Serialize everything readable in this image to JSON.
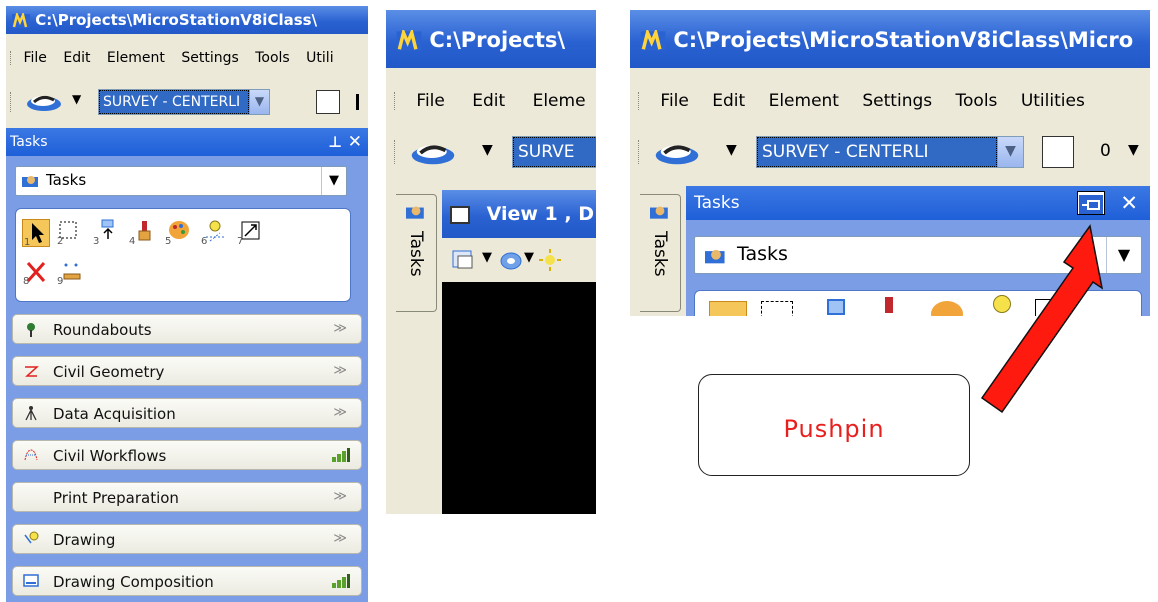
{
  "panel1": {
    "window_title": "C:\\Projects\\MicroStationV8iClass\\",
    "menu": [
      "File",
      "Edit",
      "Element",
      "Settings",
      "Tools",
      "Utili"
    ],
    "level_value": "SURVEY - CENTERLI",
    "tasks_header": "Tasks",
    "tasks_combo": "Tasks",
    "tool_numbers": [
      "1",
      "2",
      "3",
      "4",
      "5",
      "6",
      "7",
      "8",
      "9"
    ],
    "sections": [
      {
        "label": "Roundabouts",
        "icon": "roundabout-icon",
        "indicator": "chevron"
      },
      {
        "label": "Civil Geometry",
        "icon": "civil-geometry-icon",
        "indicator": "chevron"
      },
      {
        "label": "Data Acquisition",
        "icon": "survey-tripod-icon",
        "indicator": "chevron"
      },
      {
        "label": "Civil Workflows",
        "icon": "civil-workflows-icon",
        "indicator": "bars"
      },
      {
        "label": "Print Preparation",
        "icon": "",
        "indicator": "chevron"
      },
      {
        "label": "Drawing",
        "icon": "drawing-icon",
        "indicator": "chevron"
      },
      {
        "label": "Drawing Composition",
        "icon": "drawing-composition-icon",
        "indicator": "bars"
      }
    ]
  },
  "panel2": {
    "window_title": "C:\\Projects\\",
    "menu": [
      "File",
      "Edit",
      "Eleme"
    ],
    "level_value": "SURVE",
    "side_tab": "Tasks",
    "view_title": "View 1 , D"
  },
  "panel3": {
    "window_title": "C:\\Projects\\MicroStationV8iClass\\Micro",
    "menu": [
      "File",
      "Edit",
      "Element",
      "Settings",
      "Tools",
      "Utilities"
    ],
    "level_value": "SURVEY - CENTERLI",
    "weight_value": "0",
    "side_tab": "Tasks",
    "tasks_header": "Tasks",
    "tasks_combo": "Tasks"
  },
  "callout": {
    "text": "Pushpin",
    "arrow_color": "#ff1a10"
  },
  "colors": {
    "titlebar": "#2a62d2",
    "tasks_body": "#7a9de6",
    "accent_red": "#e8201d"
  }
}
